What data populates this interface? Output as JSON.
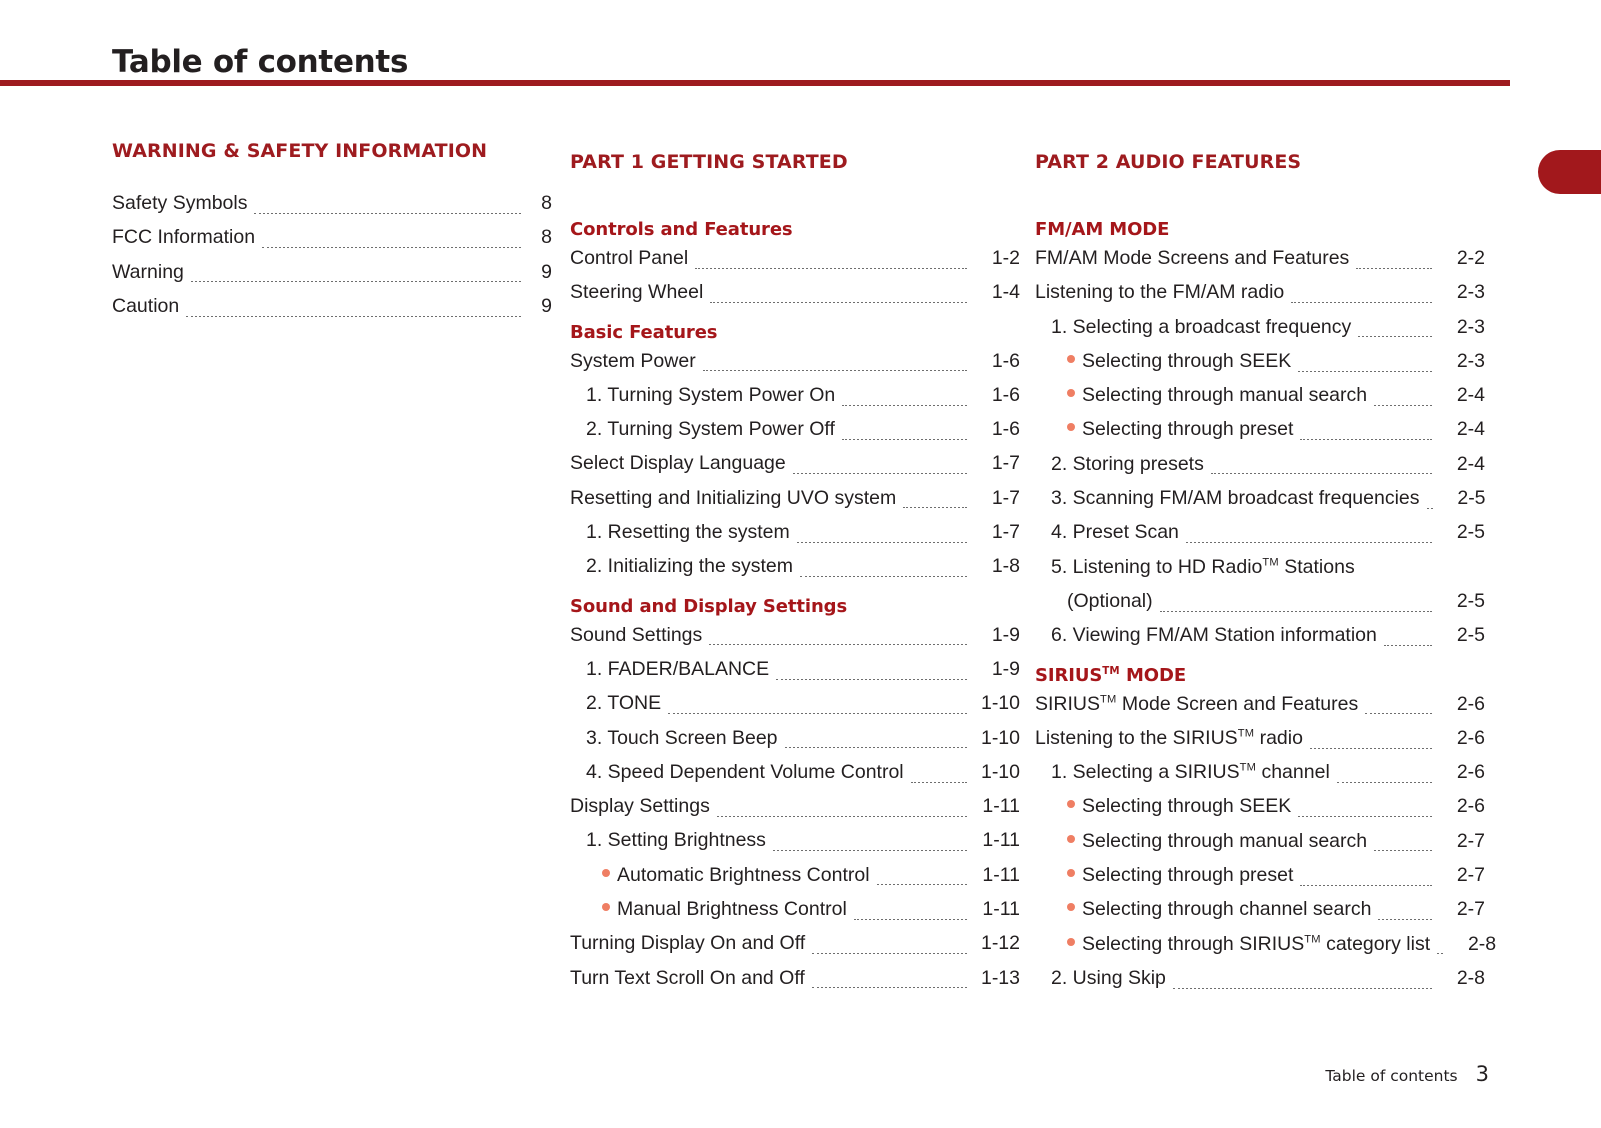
{
  "header": {
    "title": "Table of contents",
    "rule_color": "#9e1b1f"
  },
  "edge_tab": {
    "color": "#a2181c"
  },
  "columns": [
    {
      "id": "col1",
      "part_heading": "WARNING & SAFETY INFORMATION",
      "entries": [
        {
          "level": 0,
          "bullet": false,
          "label": "Safety Symbols",
          "page": "8"
        },
        {
          "level": 0,
          "bullet": false,
          "label": "FCC Information",
          "page": "8"
        },
        {
          "level": 0,
          "bullet": false,
          "label": "Warning",
          "page": "9"
        },
        {
          "level": 0,
          "bullet": false,
          "label": "Caution",
          "page": "9"
        }
      ]
    },
    {
      "id": "col2",
      "part_heading": "PART 1   GETTING STARTED",
      "groups": [
        {
          "heading": "Controls and Features",
          "entries": [
            {
              "level": 0,
              "bullet": false,
              "label": "Control Panel",
              "page": "1-2"
            },
            {
              "level": 0,
              "bullet": false,
              "label": "Steering Wheel",
              "page": "1-4"
            }
          ]
        },
        {
          "heading": "Basic Features",
          "entries": [
            {
              "level": 0,
              "bullet": false,
              "label": "System Power",
              "page": "1-6"
            },
            {
              "level": 1,
              "bullet": false,
              "label": "1. Turning System Power On",
              "page": "1-6"
            },
            {
              "level": 1,
              "bullet": false,
              "label": "2. Turning System Power Off",
              "page": "1-6"
            },
            {
              "level": 0,
              "bullet": false,
              "label": "Select Display Language",
              "page": "1-7"
            },
            {
              "level": 0,
              "bullet": false,
              "label": "Resetting and Initializing UVO system",
              "page": "1-7"
            },
            {
              "level": 1,
              "bullet": false,
              "label": "1. Resetting the system",
              "page": "1-7"
            },
            {
              "level": 1,
              "bullet": false,
              "label": "2. Initializing the system",
              "page": "1-8"
            }
          ]
        },
        {
          "heading": "Sound and Display Settings",
          "entries": [
            {
              "level": 0,
              "bullet": false,
              "label": "Sound Settings",
              "page": "1-9"
            },
            {
              "level": 1,
              "bullet": false,
              "label": "1. FADER/BALANCE",
              "page": "1-9"
            },
            {
              "level": 1,
              "bullet": false,
              "label": "2. TONE",
              "page": "1-10"
            },
            {
              "level": 1,
              "bullet": false,
              "label": "3. Touch Screen Beep",
              "page": "1-10"
            },
            {
              "level": 1,
              "bullet": false,
              "label": "4. Speed Dependent Volume Control",
              "page": "1-10"
            },
            {
              "level": 0,
              "bullet": false,
              "label": "Display Settings",
              "page": "1-11"
            },
            {
              "level": 1,
              "bullet": false,
              "label": "1. Setting Brightness",
              "page": "1-11"
            },
            {
              "level": 2,
              "bullet": true,
              "label": "Automatic Brightness Control",
              "page": "1-11"
            },
            {
              "level": 2,
              "bullet": true,
              "label": "Manual Brightness Control",
              "page": "1-11"
            },
            {
              "level": 0,
              "bullet": false,
              "label": "Turning Display On and Off",
              "page": "1-12"
            },
            {
              "level": 0,
              "bullet": false,
              "label": "Turn Text Scroll On and Off",
              "page": "1-13"
            }
          ]
        }
      ]
    },
    {
      "id": "col3",
      "part_heading": "PART 2   AUDIO FEATURES",
      "groups": [
        {
          "heading": "FM/AM MODE",
          "entries": [
            {
              "level": 0,
              "bullet": false,
              "label": "FM/AM Mode Screens and Features",
              "page": "2-2"
            },
            {
              "level": 0,
              "bullet": false,
              "label": "Listening to the FM/AM radio",
              "page": "2-3"
            },
            {
              "level": 1,
              "bullet": false,
              "label": "1. Selecting a broadcast frequency",
              "page": "2-3"
            },
            {
              "level": 2,
              "bullet": true,
              "label": "Selecting through SEEK",
              "page": "2-3"
            },
            {
              "level": 2,
              "bullet": true,
              "label": "Selecting through manual search",
              "page": "2-4"
            },
            {
              "level": 2,
              "bullet": true,
              "label": "Selecting through preset",
              "page": "2-4"
            },
            {
              "level": 1,
              "bullet": false,
              "label": "2. Storing presets",
              "page": "2-4"
            },
            {
              "level": 1,
              "bullet": false,
              "label": "3. Scanning FM/AM broadcast frequencies",
              "page": "2-5"
            },
            {
              "level": 1,
              "bullet": false,
              "label": "4. Preset Scan",
              "page": "2-5"
            },
            {
              "level": 1,
              "bullet": false,
              "label": "5. Listening to HD Radio™ Stations",
              "page": "",
              "no_leader": true
            },
            {
              "level": 2,
              "bullet": false,
              "label": "(Optional)",
              "page": "2-5"
            },
            {
              "level": 1,
              "bullet": false,
              "label": "6. Viewing FM/AM Station information",
              "page": "2-5"
            }
          ]
        },
        {
          "heading": "SIRIUS™ MODE",
          "entries": [
            {
              "level": 0,
              "bullet": false,
              "label": "SIRIUS™ Mode Screen and Features",
              "page": "2-6"
            },
            {
              "level": 0,
              "bullet": false,
              "label": "Listening to the SIRIUS™ radio",
              "page": "2-6"
            },
            {
              "level": 1,
              "bullet": false,
              "label": "1. Selecting a SIRIUS™ channel",
              "page": "2-6"
            },
            {
              "level": 2,
              "bullet": true,
              "label": "Selecting through SEEK",
              "page": "2-6"
            },
            {
              "level": 2,
              "bullet": true,
              "label": "Selecting through manual search",
              "page": "2-7"
            },
            {
              "level": 2,
              "bullet": true,
              "label": "Selecting through preset",
              "page": "2-7"
            },
            {
              "level": 2,
              "bullet": true,
              "label": "Selecting through channel search",
              "page": "2-7"
            },
            {
              "level": 2,
              "bullet": true,
              "label": "Selecting through SIRIUS™ category list",
              "page": "2-8"
            },
            {
              "level": 1,
              "bullet": false,
              "label": "2. Using Skip",
              "page": "2-8"
            }
          ]
        }
      ]
    }
  ],
  "footer": {
    "label": "Table of contents",
    "page": "3"
  }
}
